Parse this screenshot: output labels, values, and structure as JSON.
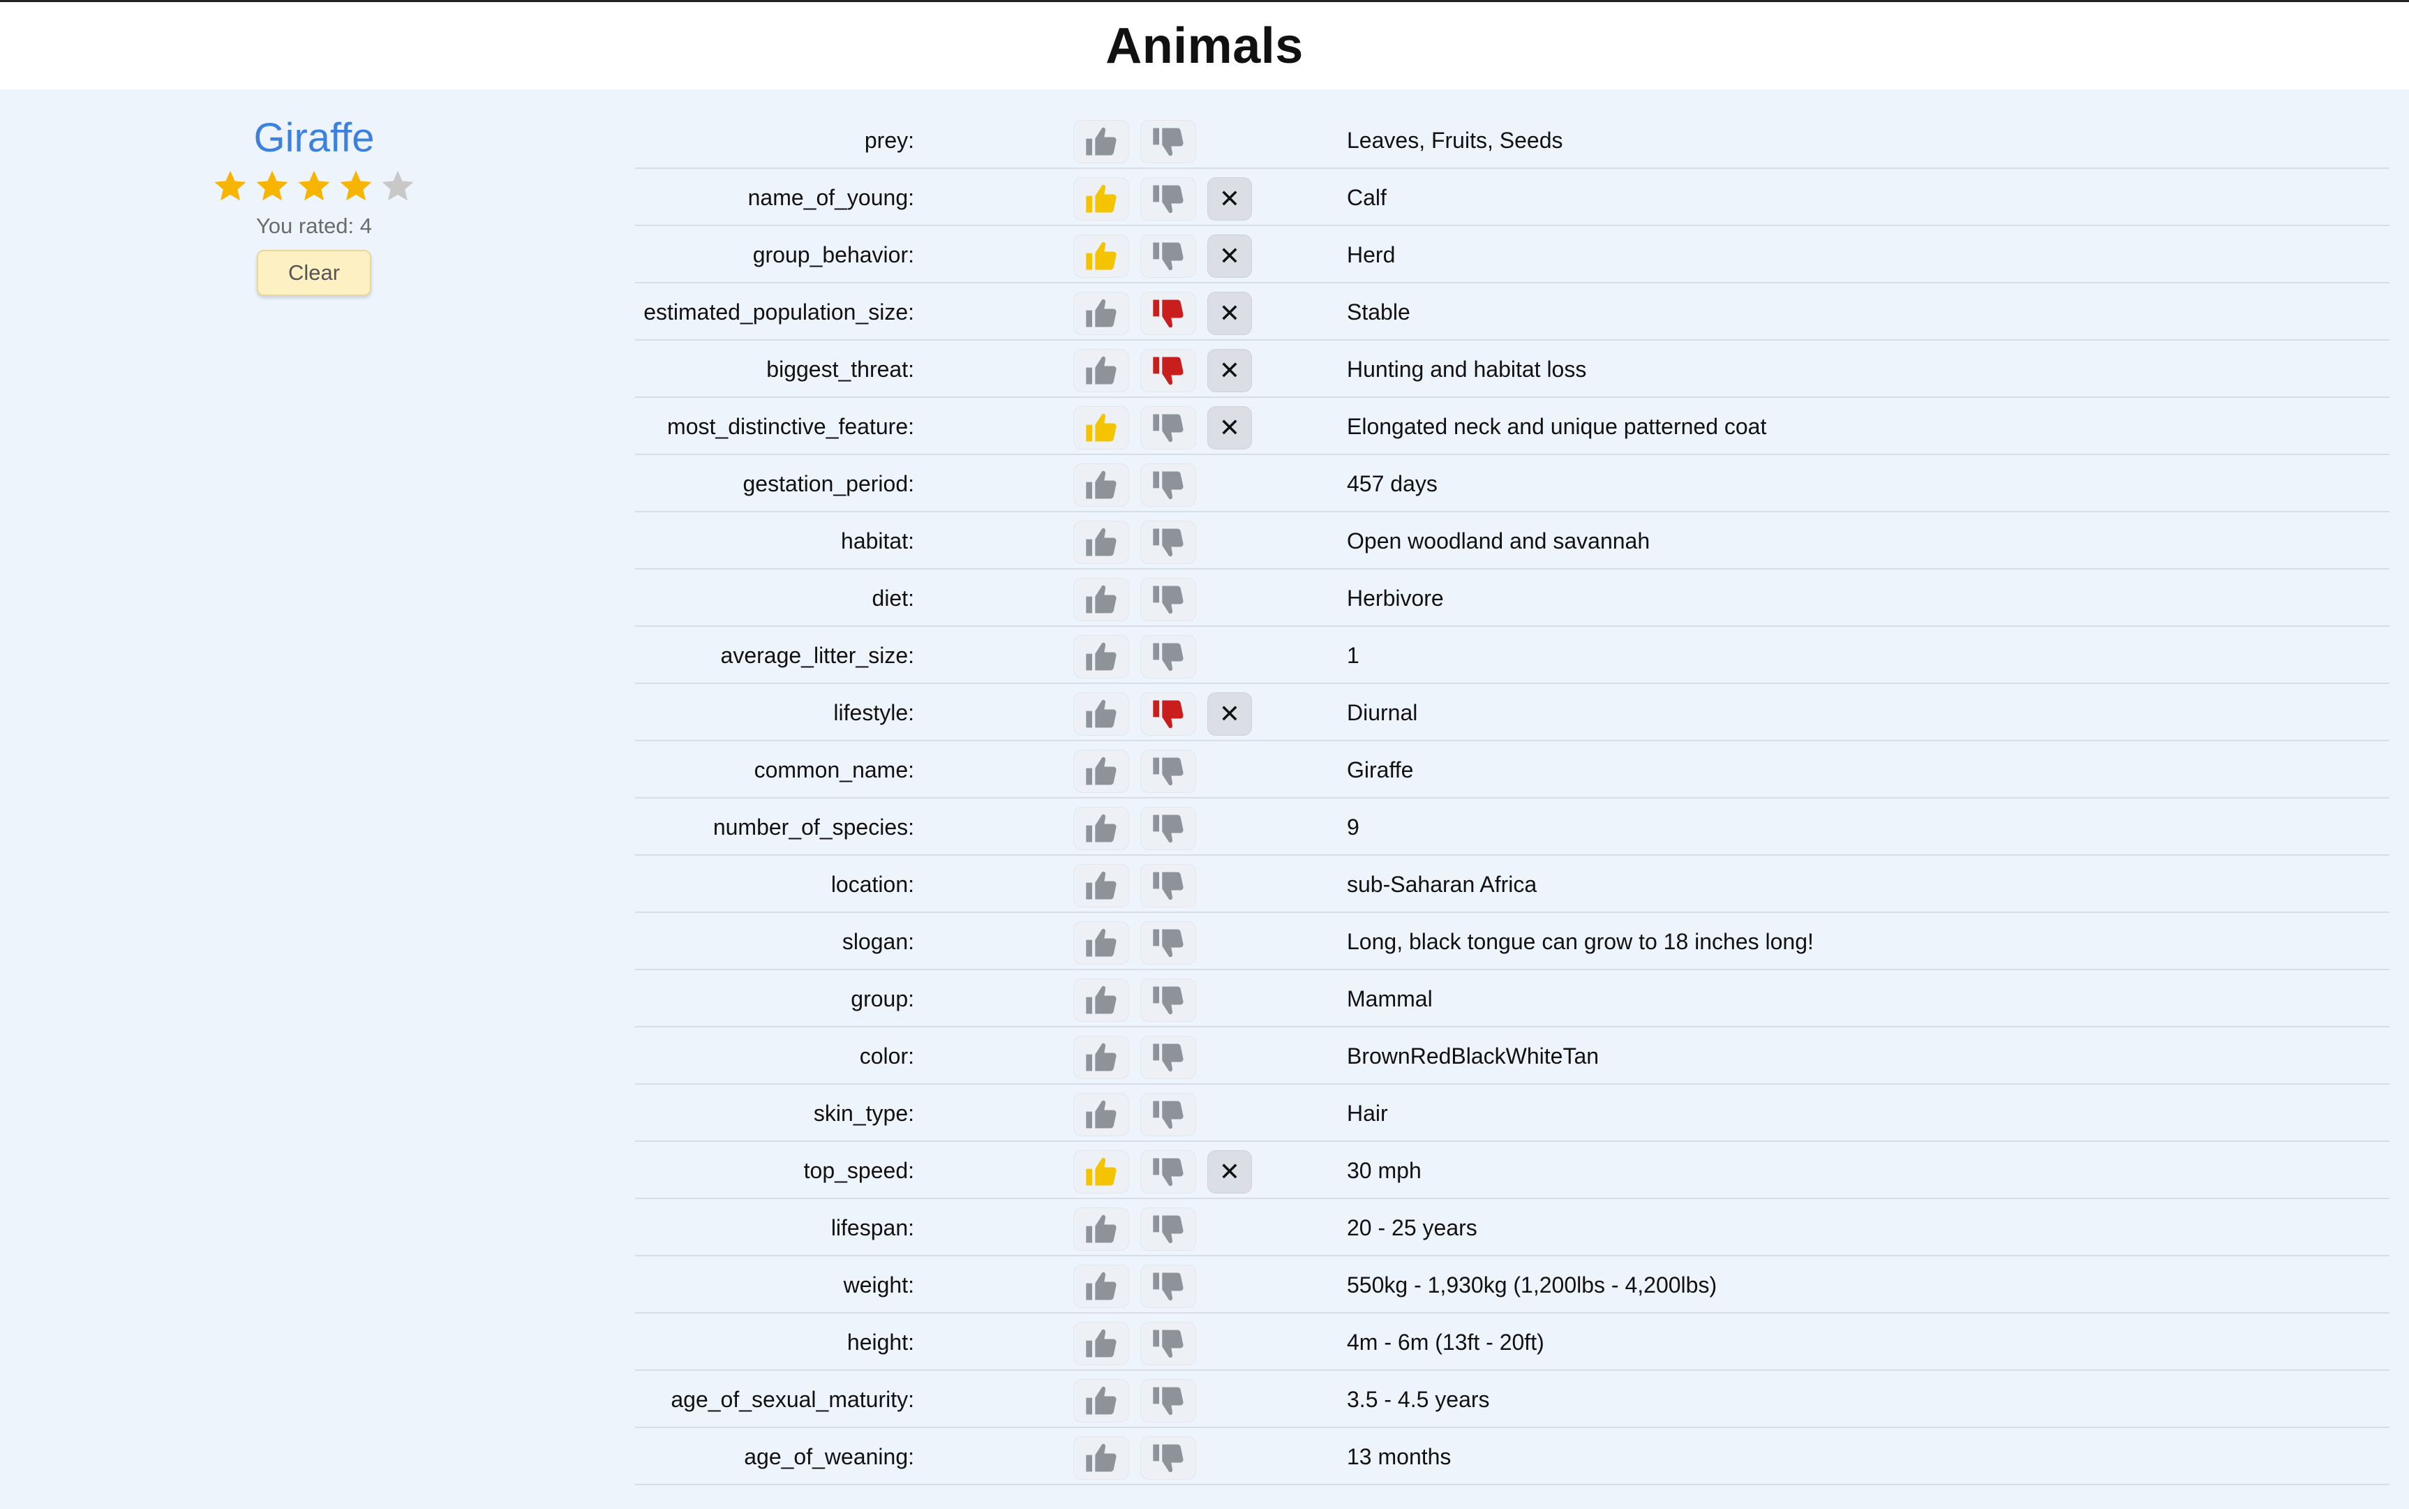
{
  "page": {
    "title": "Animals"
  },
  "animal": {
    "name": "Giraffe",
    "rating": 4,
    "max_rating": 5,
    "rated_text": "You rated: 4",
    "clear_label": "Clear",
    "colors": {
      "star_on": "#f7b500",
      "star_off": "#c8c8c8",
      "name": "#3b82e0"
    }
  },
  "vote_colors": {
    "up_active": "#f5c400",
    "down_active": "#c81e1e",
    "inactive": "#8e939a"
  },
  "clear_vote_label": "✕",
  "attributes": [
    {
      "key": "prey:",
      "value": "Leaves, Fruits, Seeds",
      "vote": "none"
    },
    {
      "key": "name_of_young:",
      "value": "Calf",
      "vote": "up"
    },
    {
      "key": "group_behavior:",
      "value": "Herd",
      "vote": "up"
    },
    {
      "key": "estimated_population_size:",
      "value": "Stable",
      "vote": "down"
    },
    {
      "key": "biggest_threat:",
      "value": "Hunting and habitat loss",
      "vote": "down"
    },
    {
      "key": "most_distinctive_feature:",
      "value": "Elongated neck and unique patterned coat",
      "vote": "up"
    },
    {
      "key": "gestation_period:",
      "value": "457 days",
      "vote": "none"
    },
    {
      "key": "habitat:",
      "value": "Open woodland and savannah",
      "vote": "none"
    },
    {
      "key": "diet:",
      "value": "Herbivore",
      "vote": "none"
    },
    {
      "key": "average_litter_size:",
      "value": "1",
      "vote": "none"
    },
    {
      "key": "lifestyle:",
      "value": "Diurnal",
      "vote": "down"
    },
    {
      "key": "common_name:",
      "value": "Giraffe",
      "vote": "none"
    },
    {
      "key": "number_of_species:",
      "value": "9",
      "vote": "none"
    },
    {
      "key": "location:",
      "value": "sub-Saharan Africa",
      "vote": "none"
    },
    {
      "key": "slogan:",
      "value": "Long, black tongue can grow to 18 inches long!",
      "vote": "none"
    },
    {
      "key": "group:",
      "value": "Mammal",
      "vote": "none"
    },
    {
      "key": "color:",
      "value": "BrownRedBlackWhiteTan",
      "vote": "none"
    },
    {
      "key": "skin_type:",
      "value": "Hair",
      "vote": "none"
    },
    {
      "key": "top_speed:",
      "value": "30 mph",
      "vote": "up"
    },
    {
      "key": "lifespan:",
      "value": "20 - 25 years",
      "vote": "none"
    },
    {
      "key": "weight:",
      "value": "550kg - 1,930kg (1,200lbs - 4,200lbs)",
      "vote": "none"
    },
    {
      "key": "height:",
      "value": "4m - 6m (13ft - 20ft)",
      "vote": "none"
    },
    {
      "key": "age_of_sexual_maturity:",
      "value": "3.5 - 4.5 years",
      "vote": "none"
    },
    {
      "key": "age_of_weaning:",
      "value": "13 months",
      "vote": "none"
    }
  ]
}
